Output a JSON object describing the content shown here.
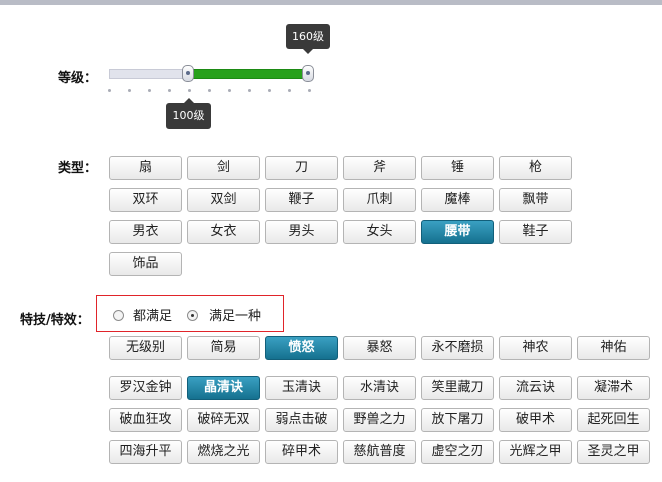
{
  "level": {
    "label": "等级：",
    "min_tip": "100级",
    "max_tip": "160级"
  },
  "type": {
    "label": "类型：",
    "rows": [
      [
        "扇",
        "剑",
        "刀",
        "斧",
        "锤",
        "枪"
      ],
      [
        "双环",
        "双剑",
        "鞭子",
        "爪刺",
        "魔棒",
        "飘带"
      ],
      [
        "男衣",
        "女衣",
        "男头",
        "女头",
        "腰带",
        "鞋子"
      ],
      [
        "饰品"
      ]
    ],
    "selected": "腰带"
  },
  "special": {
    "label": "特技/特效：",
    "radio_all": "都满足",
    "radio_any": "满足一种",
    "radio_selected": "满足一种",
    "skills": [
      "无级别",
      "简易",
      "愤怒",
      "暴怒",
      "永不磨损",
      "神农",
      "神佑"
    ],
    "selected_skill": "愤怒",
    "effects": [
      [
        "罗汉金钟",
        "晶清诀",
        "玉清诀",
        "水清诀",
        "笑里藏刀",
        "流云诀",
        "凝滞术"
      ],
      [
        "破血狂攻",
        "破碎无双",
        "弱点击破",
        "野兽之力",
        "放下屠刀",
        "破甲术",
        "起死回生"
      ],
      [
        "四海升平",
        "燃烧之光",
        "碎甲术",
        "慈航普度",
        "虚空之刃",
        "光辉之甲",
        "圣灵之甲"
      ]
    ],
    "selected_effect": "晶清诀"
  }
}
